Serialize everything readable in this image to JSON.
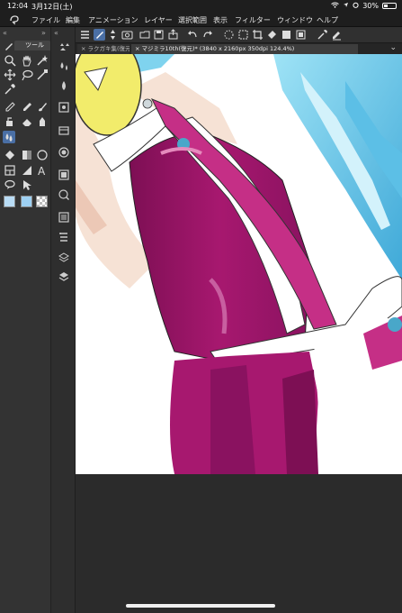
{
  "status_bar": {
    "time": "12:04",
    "date": "3月12日(土)",
    "battery": "30%"
  },
  "menu": {
    "items": [
      "ファイル",
      "編集",
      "アニメーション",
      "レイヤー",
      "選択範囲",
      "表示",
      "フィルター",
      "ウィンドウ",
      "ヘルプ"
    ]
  },
  "tool_palette": {
    "tab_label": "ツール"
  },
  "document_tabs": {
    "inactive_tab": "ラクガキ集(復元)",
    "active_tab": "マジミラ10th(復元)* (3840 x 2160px 350dpi 124.4%)"
  },
  "colors": {
    "main_color": "#b9dcf5",
    "sub_color": "#9ed0f2",
    "suit": "#a7186f",
    "skin": "#f6e2d5",
    "hair": "#7fd3ee",
    "accent_yellow": "#f2ec6b"
  },
  "icons": [
    "menu-icon",
    "pen-tool-icon",
    "selection-tool-icon",
    "undo-icon",
    "redo-icon",
    "transform-icon",
    "fill-icon",
    "eyedropper-icon",
    "collapse-chevron-icon"
  ]
}
